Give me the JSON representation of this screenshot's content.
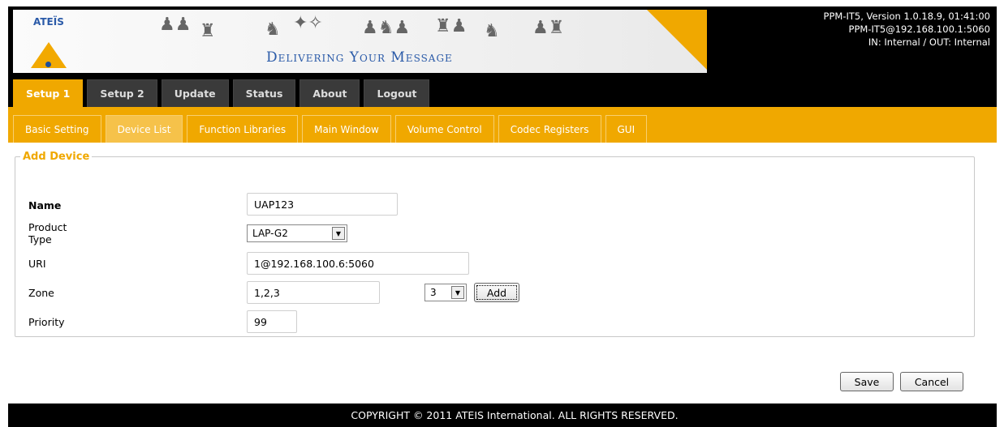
{
  "header": {
    "logo_text": "ATEÏS",
    "tagline": "Delivering Your Message",
    "info_line1": "PPM-IT5, Version 1.0.18.9, 01:41:00",
    "info_line2": "PPM-IT5@192.168.100.1:5060",
    "info_line3": "IN: Internal / OUT: Internal"
  },
  "tabs": [
    "Setup 1",
    "Setup 2",
    "Update",
    "Status",
    "About",
    "Logout"
  ],
  "subtabs": [
    "Basic Setting",
    "Device List",
    "Function Libraries",
    "Main Window",
    "Volume Control",
    "Codec Registers",
    "GUI"
  ],
  "form": {
    "legend": "Add Device",
    "name_label": "Name",
    "name_value": "UAP123",
    "product_type_label": "Product Type",
    "product_type_value": "LAP-G2",
    "uri_label": "URI",
    "uri_value": "1@192.168.100.6:5060",
    "zone_label": "Zone",
    "zone_value": "1,2,3",
    "zone_select_value": "3",
    "add_label": "Add",
    "priority_label": "Priority",
    "priority_value": "99"
  },
  "actions": {
    "save_label": "Save",
    "cancel_label": "Cancel"
  },
  "footer": {
    "copyright": "COPYRIGHT © 2011 ATEIS International. ALL RIGHTS RESERVED."
  },
  "colors": {
    "accent": "#f0a800",
    "tab_inactive": "#3a3a3a",
    "legend": "#f0a800"
  }
}
